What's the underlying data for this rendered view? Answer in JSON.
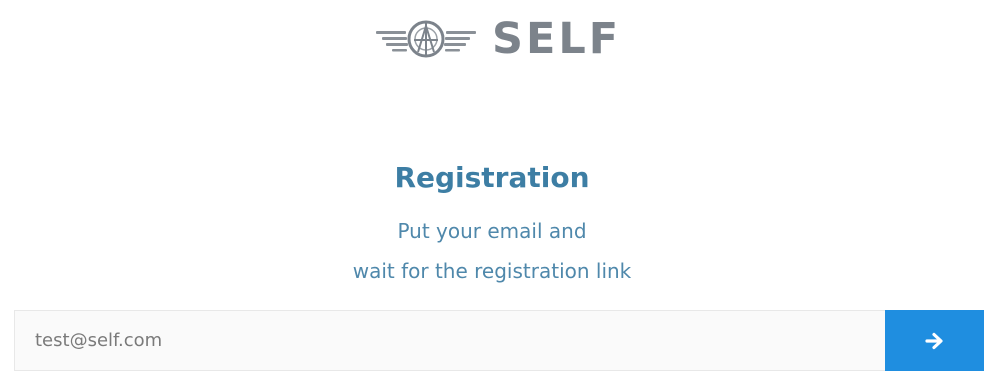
{
  "logo": {
    "text": "SELF",
    "icon": "winged-wheel-emblem"
  },
  "registration": {
    "title": "Registration",
    "subtitle_line1": "Put your email and",
    "subtitle_line2": "wait for the registration link"
  },
  "form": {
    "email_placeholder": "test@self.com",
    "submit_icon": "arrow-right-icon"
  },
  "colors": {
    "title": "#3d7ea4",
    "subtitle": "#4f88ab",
    "logo": "#7c838b",
    "button": "#1f8ee0"
  }
}
